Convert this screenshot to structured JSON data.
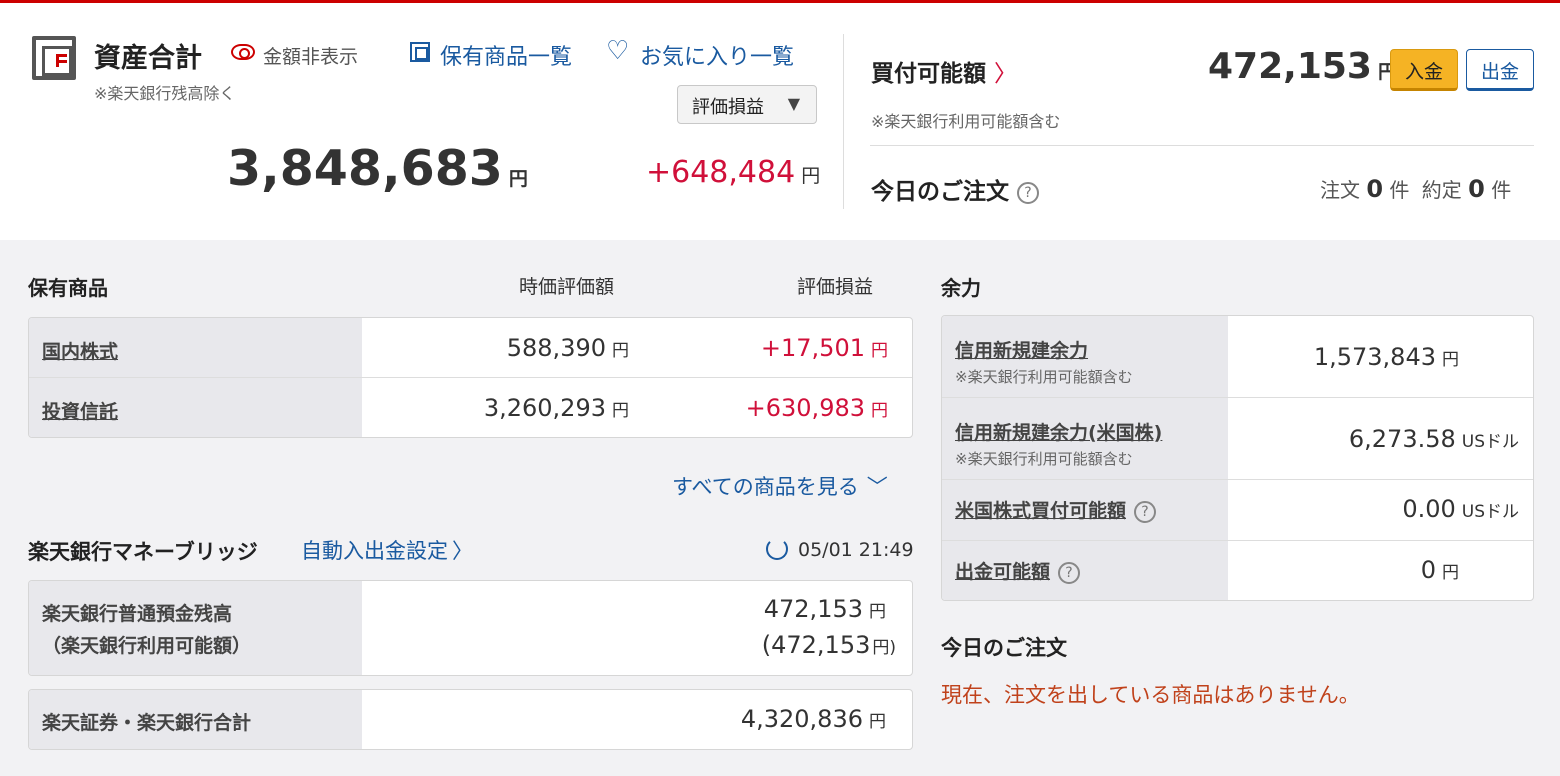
{
  "assets": {
    "title": "資産合計",
    "hide_label": "金額非表示",
    "note": "※楽天銀行残高除く",
    "holdings_link": "保有商品一覧",
    "favorites_link": "お気に入り一覧",
    "select_value": "評価損益",
    "select_arrow": "▼",
    "total": "3,848,683",
    "total_unit": "円",
    "profit": "+648,484",
    "profit_unit": "円"
  },
  "buying_power": {
    "title": "買付可能額",
    "chevron": "〉",
    "amount": "472,153",
    "unit": "円",
    "deposit_button": "入金",
    "withdraw_button": "出金",
    "note": "※楽天銀行利用可能額含む"
  },
  "today_order_header": {
    "title": "今日のご注文",
    "q": "?",
    "order_label": "注文",
    "order_count": "0",
    "order_unit": "件",
    "exec_label": "約定",
    "exec_count": "0",
    "exec_unit": "件"
  },
  "holdings": {
    "title": "保有商品",
    "col_value": "時価評価額",
    "col_profit": "評価損益",
    "rows": [
      {
        "name": "国内株式",
        "value": "588,390",
        "unit": "円",
        "profit": "+17,501",
        "profit_unit": "円"
      },
      {
        "name": "投資信託",
        "value": "3,260,293",
        "unit": "円",
        "profit": "+630,983",
        "profit_unit": "円"
      }
    ],
    "see_all": "すべての商品を見る",
    "see_all_chevron": "﹀"
  },
  "bridge": {
    "title": "楽天銀行マネーブリッジ",
    "auto_link": "自動入出金設定",
    "auto_chevron": "〉",
    "timestamp": "05/01 21:49",
    "row1_label1": "楽天銀行普通預金残高",
    "row1_label2": "（楽天銀行利用可能額）",
    "row1_value": "472,153",
    "row1_unit": "円",
    "row1_value2": "(472,153",
    "row1_unit2": "円)",
    "row2_label": "楽天証券・楽天銀行合計",
    "row2_value": "4,320,836",
    "row2_unit": "円"
  },
  "yoryoku": {
    "title": "余力",
    "rows": [
      {
        "name": "信用新規建余力",
        "note": "※楽天銀行利用可能額含む",
        "value": "1,573,843",
        "unit": "円"
      },
      {
        "name": "信用新規建余力(米国株)",
        "note": "※楽天銀行利用可能額含む",
        "value": "6,273.58",
        "unit": "USドル"
      },
      {
        "name": "米国株式買付可能額",
        "value": "0.00",
        "unit": "USドル",
        "q": "?"
      },
      {
        "name": "出金可能額",
        "value": "0",
        "unit": "円",
        "q": "?"
      }
    ]
  },
  "today_orders": {
    "title": "今日のご注文",
    "message": "現在、注文を出している商品はありません。"
  }
}
